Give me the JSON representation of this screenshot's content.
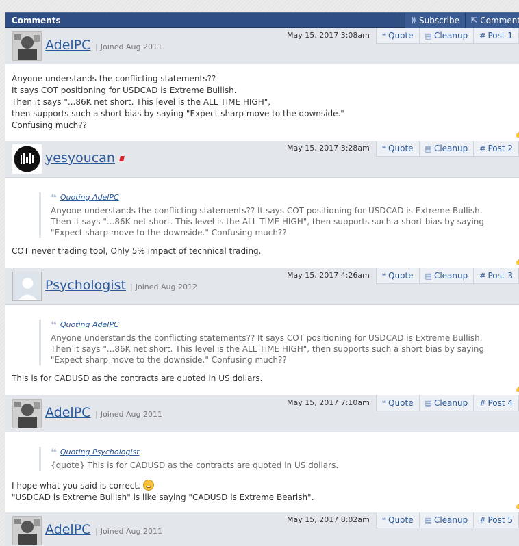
{
  "header": {
    "title": "Comments",
    "subscribe_label": "Subscribe",
    "comment_label": "Comment"
  },
  "actions": {
    "quote": "Quote",
    "cleanup": "Cleanup"
  },
  "posts": [
    {
      "user": "AdelPC",
      "joined": "Joined Aug 2011",
      "date": "May 15, 2017 3:08am",
      "post": "Post 1",
      "lines": [
        "Anyone understands the conflicting statements??",
        "It says COT positioning for USDCAD is Extreme Bullish.",
        "Then it says \"...86K net short. This level is the ALL TIME HIGH\",",
        "then supports such a short bias by saying \"Expect sharp move to the downside.\"",
        "Confusing much??"
      ]
    },
    {
      "user": "yesyoucan",
      "joined": "",
      "date": "May 15, 2017 3:28am",
      "post": "Post 2",
      "quote_author": "Quoting AdelPC",
      "quote_lines": [
        "Anyone understands the conflicting statements?? It says COT positioning for USDCAD is Extreme Bullish.",
        "Then it says \"...86K net short. This level is the ALL TIME HIGH\", then supports such a short bias by saying",
        "\"Expect sharp move to the downside.\" Confusing much??"
      ],
      "lines": [
        "COT never trading tool, Only 5% impact of technical trading."
      ]
    },
    {
      "user": "Psychologist",
      "joined": "Joined Aug 2012",
      "date": "May 15, 2017 4:26am",
      "post": "Post 3",
      "quote_author": "Quoting AdelPC",
      "quote_lines": [
        "Anyone understands the conflicting statements?? It says COT positioning for USDCAD is Extreme Bullish.",
        "Then it says \"...86K net short. This level is the ALL TIME HIGH\", then supports such a short bias by saying",
        "\"Expect sharp move to the downside.\" Confusing much??"
      ],
      "lines": [
        "This is for CADUSD as the contracts are quoted in US dollars."
      ]
    },
    {
      "user": "AdelPC",
      "joined": "Joined Aug 2011",
      "date": "May 15, 2017 7:10am",
      "post": "Post 4",
      "quote_author": "Quoting Psychologist",
      "quote_lines": [
        "{quote} This is for CADUSD as the contracts are quoted in US dollars."
      ],
      "lines": [
        "I hope what you said is correct.",
        "\"USDCAD is Extreme Bullish\" is like saying \"CADUSD is Extreme Bearish\"."
      ]
    },
    {
      "user": "AdelPC",
      "joined": "Joined Aug 2011",
      "date": "May 15, 2017 8:02am",
      "post": "Post 5"
    }
  ]
}
